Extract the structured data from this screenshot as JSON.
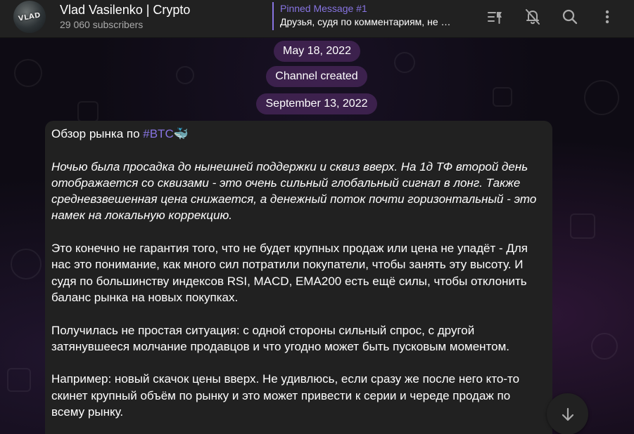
{
  "header": {
    "channel_name": "Vlad Vasilenko | Crypto",
    "subscribers": "29 060 subscribers",
    "avatar_text": "VLAD",
    "pinned_title": "Pinned Message #1",
    "pinned_text": "Друзья, судя по комментариям, не …",
    "icons": [
      "pin-list-icon",
      "bell-off-icon",
      "search-icon",
      "more-vertical-icon"
    ]
  },
  "service": {
    "date1": "May 18, 2022",
    "channel_created": "Channel created",
    "date2": "September 13, 2022"
  },
  "message": {
    "intro": "Обзор рынка по ",
    "hashtag": "#BTC",
    "emoji": "🐳",
    "p1": "Ночью была просадка до нынешней поддержки и сквиз вверх. На 1д ТФ второй день отображается со сквизами - это очень сильный глобальный сигнал в лонг. Также средневзвешенная цена снижается, а денежный поток почти горизонтальный - это намек на локальную коррекцию.",
    "p2": "Это конечно не гарантия того, что не будет крупных продаж или цена не упадёт - Для нас это понимание, как много сил потратили покупатели, чтобы занять эту высоту. И судя по большинству индексов RSI, MACD, EMA200 есть ещё силы, чтобы отклонить баланс рынка на новых покупках.",
    "p3": "Получилась не простая ситуация: с одной стороны сильный спрос, с другой затянувшееся молчание продавцов и что угодно может быть пусковым моментом.",
    "p4": "Например: новый скачок цены вверх. Не удивлюсь, если сразу же после него кто-то скинет крупный объём по рынку и это может привести к серии и череде продаж по всему рынку."
  },
  "colors": {
    "accent": "#8774e1",
    "header_bg": "#212121",
    "bubble_bg": "#212121",
    "service_bg": "#48265a"
  }
}
